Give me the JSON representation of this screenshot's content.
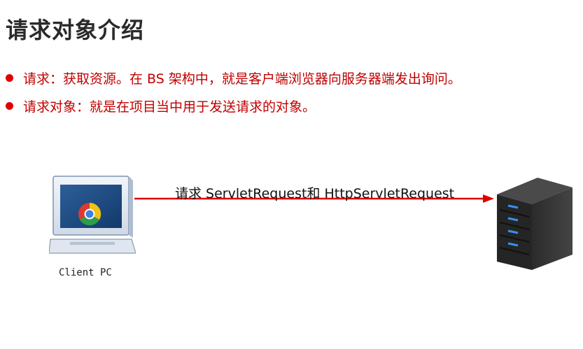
{
  "slide": {
    "title": "请求对象介绍",
    "bullets": [
      "请求：获取资源。在 BS 架构中，就是客户端浏览器向服务器端发出询问。",
      "请求对象：就是在项目当中用于发送请求的对象。"
    ]
  },
  "diagram": {
    "client_label": "Client PC",
    "arrow_label": "请求   ServletRequest和 HttpServletRequest",
    "arrow_color": "#e00000",
    "client_icon": "computer-with-chrome-icon",
    "server_icon": "server-tower-icon"
  }
}
